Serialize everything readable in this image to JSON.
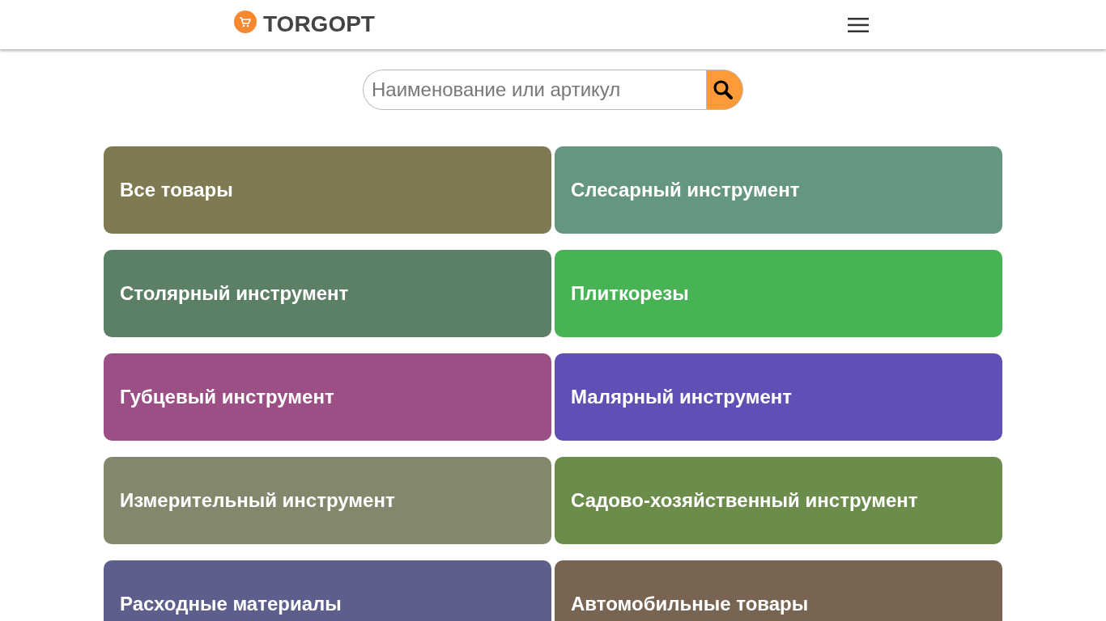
{
  "header": {
    "logo_text": "TORGOPT"
  },
  "search": {
    "placeholder": "Наименование или артикул"
  },
  "categories": [
    {
      "label": "Все товары",
      "color": "#7f7a52"
    },
    {
      "label": "Слесарный инструмент",
      "color": "#659680"
    },
    {
      "label": "Столярный инструмент",
      "color": "#5c8066"
    },
    {
      "label": "Плиткорезы",
      "color": "#47b355"
    },
    {
      "label": "Губцевый инструмент",
      "color": "#9c4f85"
    },
    {
      "label": "Малярный инструмент",
      "color": "#5e50b5"
    },
    {
      "label": "Измерительный инструмент",
      "color": "#82886b"
    },
    {
      "label": "Садово-хозяйственный инструмент",
      "color": "#6c8c4b"
    },
    {
      "label": "Расходные материалы",
      "color": "#5e5e8c"
    },
    {
      "label": "Автомобильные товары",
      "color": "#786452"
    }
  ]
}
